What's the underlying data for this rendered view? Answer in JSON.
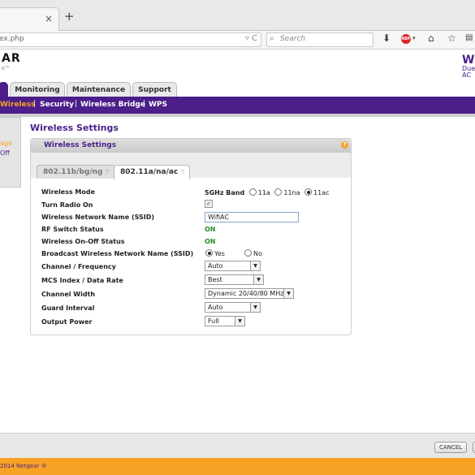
{
  "browser": {
    "new_tab": "+",
    "tab_close": "×",
    "url": "ex.php",
    "url_icons": "▿ C",
    "search_placeholder": "Search"
  },
  "brand": {
    "logo": "AR",
    "logo_sub": "n™",
    "product_line1": "W",
    "product_line2": "Due",
    "product_line3": "AC"
  },
  "main_tabs": [
    "Monitoring",
    "Maintenance",
    "Support"
  ],
  "sub_nav": [
    "Wireless",
    "Security",
    "Wireless Bridge",
    "WPS"
  ],
  "left_panel": [
    "age",
    "Off"
  ],
  "page_title": "Wireless Settings",
  "panel_title": "Wireless Settings",
  "help": "?",
  "band_tabs": [
    "802.11b/bg/ng",
    "802.11a/na/ac"
  ],
  "form": {
    "mode": {
      "label": "Wireless Mode",
      "band": "5GHz Band",
      "options": [
        "11a",
        "11na",
        "11ac"
      ],
      "selected": "11ac"
    },
    "radio_on": {
      "label": "Turn Radio On",
      "checked": true
    },
    "ssid": {
      "label": "Wireless Network Name (SSID)",
      "value": "WifiAC"
    },
    "rf_switch": {
      "label": "RF Switch Status",
      "value": "ON"
    },
    "onoff": {
      "label": "Wireless On-Off Status",
      "value": "ON"
    },
    "broadcast": {
      "label": "Broadcast Wireless Network Name (SSID)",
      "options": [
        "Yes",
        "No"
      ],
      "selected": "Yes"
    },
    "channel": {
      "label": "Channel / Frequency",
      "value": "Auto"
    },
    "mcs": {
      "label": "MCS Index / Data Rate",
      "value": "Best"
    },
    "width": {
      "label": "Channel Width",
      "value": "Dynamic 20/40/80 MHz"
    },
    "guard": {
      "label": "Guard Interval",
      "value": "Auto"
    },
    "power": {
      "label": "Output Power",
      "value": "Full"
    }
  },
  "buttons": {
    "cancel": "CANCEL"
  },
  "footer": {
    "copyright": "2014 Netgear ®"
  },
  "colors": {
    "brand_purple": "#4b1e8a",
    "accent_orange": "#f7a224",
    "status_green": "#2a8a2a"
  }
}
